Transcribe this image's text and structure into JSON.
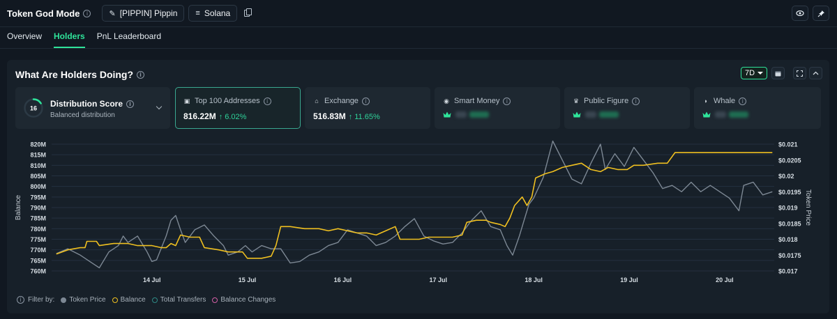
{
  "header": {
    "title": "Token God Mode",
    "token_label": "[PIPPIN] Pippin",
    "chain_label": "Solana"
  },
  "tabs": [
    {
      "label": "Overview",
      "active": false
    },
    {
      "label": "Holders",
      "active": true
    },
    {
      "label": "PnL Leaderboard",
      "active": false
    }
  ],
  "panel": {
    "title": "What Are Holders Doing?",
    "range": "7D"
  },
  "distribution": {
    "score": "16",
    "title": "Distribution Score",
    "subtitle": "Balanced distribution",
    "score_fraction": 0.16
  },
  "cards": [
    {
      "label": "Top 100 Addresses",
      "value": "816.22M",
      "change": "↑ 6.02%",
      "icon": "wallet-icon",
      "selected": true
    },
    {
      "label": "Exchange",
      "value": "516.83M",
      "change": "↑ 11.65%",
      "icon": "bank-icon",
      "selected": false
    },
    {
      "label": "Smart Money",
      "icon": "brain-icon",
      "selected": false
    },
    {
      "label": "Public Figure",
      "icon": "trophy-icon",
      "selected": false
    },
    {
      "label": "Whale",
      "icon": "whale-icon",
      "selected": false
    }
  ],
  "legend": {
    "filter_label": "Filter by:",
    "items": [
      "Token Price",
      "Balance",
      "Total Transfers",
      "Balance Changes"
    ]
  },
  "colors": {
    "accent": "#2fe39a",
    "balance_line": "#f0c020",
    "price_line": "#7d8894"
  },
  "chart_data": {
    "type": "line",
    "xlabel": "",
    "ylabel": "Balance",
    "y2label": "Token Price",
    "x_ticks": [
      "14 Jul",
      "15 Jul",
      "16 Jul",
      "17 Jul",
      "18 Jul",
      "19 Jul",
      "20 Jul"
    ],
    "y_ticks": [
      "820M",
      "815M",
      "810M",
      "805M",
      "800M",
      "795M",
      "790M",
      "785M",
      "780M",
      "775M",
      "770M",
      "765M",
      "760M"
    ],
    "y2_ticks": [
      "$0.021",
      "$0.0205",
      "$0.02",
      "$0.0195",
      "$0.019",
      "$0.0185",
      "$0.018",
      "$0.0175",
      "$0.017"
    ],
    "ylim": [
      760,
      820
    ],
    "y2lim": [
      0.017,
      0.021
    ],
    "grid": true,
    "series": [
      {
        "name": "Balance",
        "axis": "left",
        "points": [
          [
            0,
            768
          ],
          [
            0.12,
            770
          ],
          [
            0.25,
            771
          ],
          [
            0.3,
            771
          ],
          [
            0.32,
            774
          ],
          [
            0.42,
            774
          ],
          [
            0.45,
            772
          ],
          [
            0.6,
            773
          ],
          [
            0.75,
            773
          ],
          [
            0.85,
            772
          ],
          [
            1.0,
            772
          ],
          [
            1.1,
            771
          ],
          [
            1.15,
            771
          ],
          [
            1.2,
            773
          ],
          [
            1.25,
            772
          ],
          [
            1.3,
            777
          ],
          [
            1.4,
            776
          ],
          [
            1.5,
            776
          ],
          [
            1.55,
            771
          ],
          [
            1.7,
            770
          ],
          [
            1.8,
            769
          ],
          [
            1.95,
            769
          ],
          [
            2.0,
            766
          ],
          [
            2.15,
            766
          ],
          [
            2.25,
            767
          ],
          [
            2.3,
            772
          ],
          [
            2.35,
            781
          ],
          [
            2.45,
            781
          ],
          [
            2.6,
            780
          ],
          [
            2.75,
            780
          ],
          [
            2.85,
            779
          ],
          [
            2.95,
            780
          ],
          [
            3.05,
            779
          ],
          [
            3.15,
            778
          ],
          [
            3.25,
            778
          ],
          [
            3.35,
            777
          ],
          [
            3.45,
            779
          ],
          [
            3.55,
            781
          ],
          [
            3.6,
            775
          ],
          [
            3.7,
            775
          ],
          [
            3.8,
            775
          ],
          [
            3.9,
            776
          ],
          [
            4.05,
            776
          ],
          [
            4.15,
            776
          ],
          [
            4.25,
            777
          ],
          [
            4.3,
            783
          ],
          [
            4.4,
            784
          ],
          [
            4.5,
            784
          ],
          [
            4.55,
            783
          ],
          [
            4.65,
            782
          ],
          [
            4.7,
            781
          ],
          [
            4.75,
            785
          ],
          [
            4.8,
            791
          ],
          [
            4.88,
            795
          ],
          [
            4.93,
            791
          ],
          [
            4.98,
            795
          ],
          [
            5.02,
            804
          ],
          [
            5.12,
            806
          ],
          [
            5.2,
            807
          ],
          [
            5.3,
            809
          ],
          [
            5.4,
            810
          ],
          [
            5.5,
            811
          ],
          [
            5.6,
            808
          ],
          [
            5.7,
            807
          ],
          [
            5.78,
            809
          ],
          [
            5.88,
            808
          ],
          [
            5.98,
            808
          ],
          [
            6.05,
            810
          ],
          [
            6.15,
            810
          ],
          [
            6.3,
            811
          ],
          [
            6.4,
            811
          ],
          [
            6.48,
            816
          ],
          [
            6.6,
            816
          ],
          [
            6.8,
            816
          ],
          [
            7.0,
            816
          ],
          [
            7.2,
            816
          ],
          [
            7.4,
            816
          ],
          [
            7.5,
            816
          ]
        ]
      },
      {
        "name": "Token Price",
        "axis": "right",
        "points": [
          [
            0,
            0.01755
          ],
          [
            0.12,
            0.0177
          ],
          [
            0.25,
            0.0175
          ],
          [
            0.35,
            0.0173
          ],
          [
            0.45,
            0.0171
          ],
          [
            0.55,
            0.0176
          ],
          [
            0.65,
            0.0178
          ],
          [
            0.7,
            0.0181
          ],
          [
            0.75,
            0.0179
          ],
          [
            0.85,
            0.0181
          ],
          [
            0.95,
            0.0176
          ],
          [
            1.0,
            0.0173
          ],
          [
            1.05,
            0.01735
          ],
          [
            1.15,
            0.0181
          ],
          [
            1.2,
            0.0186
          ],
          [
            1.25,
            0.01875
          ],
          [
            1.3,
            0.0183
          ],
          [
            1.35,
            0.0179
          ],
          [
            1.45,
            0.0183
          ],
          [
            1.55,
            0.01845
          ],
          [
            1.65,
            0.0181
          ],
          [
            1.75,
            0.0178
          ],
          [
            1.8,
            0.0175
          ],
          [
            1.9,
            0.0176
          ],
          [
            1.98,
            0.0178
          ],
          [
            2.05,
            0.0176
          ],
          [
            2.15,
            0.0178
          ],
          [
            2.25,
            0.0177
          ],
          [
            2.35,
            0.0177
          ],
          [
            2.45,
            0.01725
          ],
          [
            2.55,
            0.0173
          ],
          [
            2.65,
            0.0175
          ],
          [
            2.75,
            0.0176
          ],
          [
            2.85,
            0.0178
          ],
          [
            2.95,
            0.0179
          ],
          [
            3.05,
            0.0183
          ],
          [
            3.15,
            0.0182
          ],
          [
            3.25,
            0.0181
          ],
          [
            3.35,
            0.0178
          ],
          [
            3.45,
            0.0179
          ],
          [
            3.55,
            0.0181
          ],
          [
            3.65,
            0.0184
          ],
          [
            3.75,
            0.01865
          ],
          [
            3.85,
            0.0181
          ],
          [
            3.95,
            0.01795
          ],
          [
            4.05,
            0.01785
          ],
          [
            4.15,
            0.0179
          ],
          [
            4.25,
            0.0182
          ],
          [
            4.35,
            0.0186
          ],
          [
            4.45,
            0.0189
          ],
          [
            4.55,
            0.0184
          ],
          [
            4.65,
            0.0183
          ],
          [
            4.72,
            0.0178
          ],
          [
            4.78,
            0.0175
          ],
          [
            4.85,
            0.0181
          ],
          [
            4.9,
            0.0186
          ],
          [
            4.95,
            0.0191
          ],
          [
            5.0,
            0.0193
          ],
          [
            5.1,
            0.01995
          ],
          [
            5.2,
            0.0211
          ],
          [
            5.3,
            0.0205
          ],
          [
            5.4,
            0.0199
          ],
          [
            5.5,
            0.01975
          ],
          [
            5.6,
            0.0204
          ],
          [
            5.7,
            0.021
          ],
          [
            5.75,
            0.0202
          ],
          [
            5.85,
            0.0207
          ],
          [
            5.95,
            0.0203
          ],
          [
            6.05,
            0.0209
          ],
          [
            6.15,
            0.0205
          ],
          [
            6.25,
            0.0201
          ],
          [
            6.35,
            0.0196
          ],
          [
            6.45,
            0.0197
          ],
          [
            6.55,
            0.0195
          ],
          [
            6.65,
            0.0198
          ],
          [
            6.75,
            0.0195
          ],
          [
            6.85,
            0.0197
          ],
          [
            6.95,
            0.0195
          ],
          [
            7.05,
            0.0193
          ],
          [
            7.15,
            0.0189
          ],
          [
            7.2,
            0.0197
          ],
          [
            7.3,
            0.0198
          ],
          [
            7.4,
            0.0194
          ],
          [
            7.5,
            0.0195
          ]
        ]
      }
    ]
  }
}
